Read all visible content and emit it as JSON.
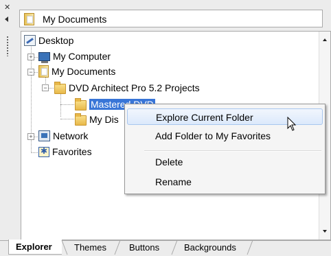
{
  "location": {
    "label": "My Documents"
  },
  "tree": {
    "nodes": {
      "desktop": "Desktop",
      "my_computer": "My Computer",
      "my_documents": "My Documents",
      "dvd_projects": "DVD Architect Pro 5.2 Projects",
      "mastered_dvd": "Mastered DVD",
      "my_dis": "My Dis",
      "network": "Network",
      "favorites": "Favorites"
    }
  },
  "context_menu": {
    "items": [
      "Explore Current Folder",
      "Add Folder to My Favorites",
      "Delete",
      "Rename"
    ]
  },
  "tabs": [
    "Explorer",
    "Themes",
    "Buttons",
    "Backgrounds"
  ]
}
